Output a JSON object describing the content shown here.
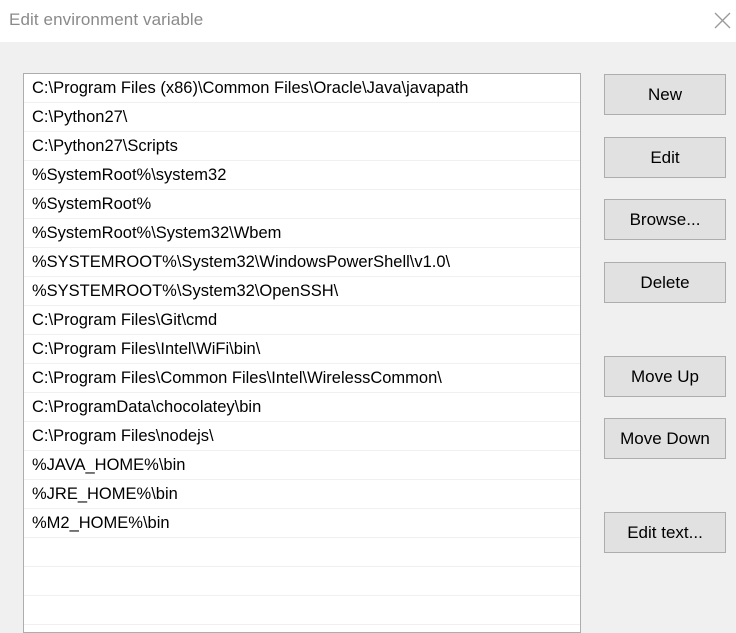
{
  "window": {
    "title": "Edit environment variable"
  },
  "path_entries": [
    "C:\\Program Files (x86)\\Common Files\\Oracle\\Java\\javapath",
    "C:\\Python27\\",
    "C:\\Python27\\Scripts",
    "%SystemRoot%\\system32",
    "%SystemRoot%",
    "%SystemRoot%\\System32\\Wbem",
    "%SYSTEMROOT%\\System32\\WindowsPowerShell\\v1.0\\",
    "%SYSTEMROOT%\\System32\\OpenSSH\\",
    "C:\\Program Files\\Git\\cmd",
    "C:\\Program Files\\Intel\\WiFi\\bin\\",
    "C:\\Program Files\\Common Files\\Intel\\WirelessCommon\\",
    "C:\\ProgramData\\chocolatey\\bin",
    "C:\\Program Files\\nodejs\\",
    "%JAVA_HOME%\\bin",
    "%JRE_HOME%\\bin",
    "%M2_HOME%\\bin"
  ],
  "buttons": {
    "new": "New",
    "edit": "Edit",
    "browse": "Browse...",
    "delete": "Delete",
    "move_up": "Move Up",
    "move_down": "Move Down",
    "edit_text": "Edit text..."
  },
  "icons": {
    "close": "close-icon"
  }
}
